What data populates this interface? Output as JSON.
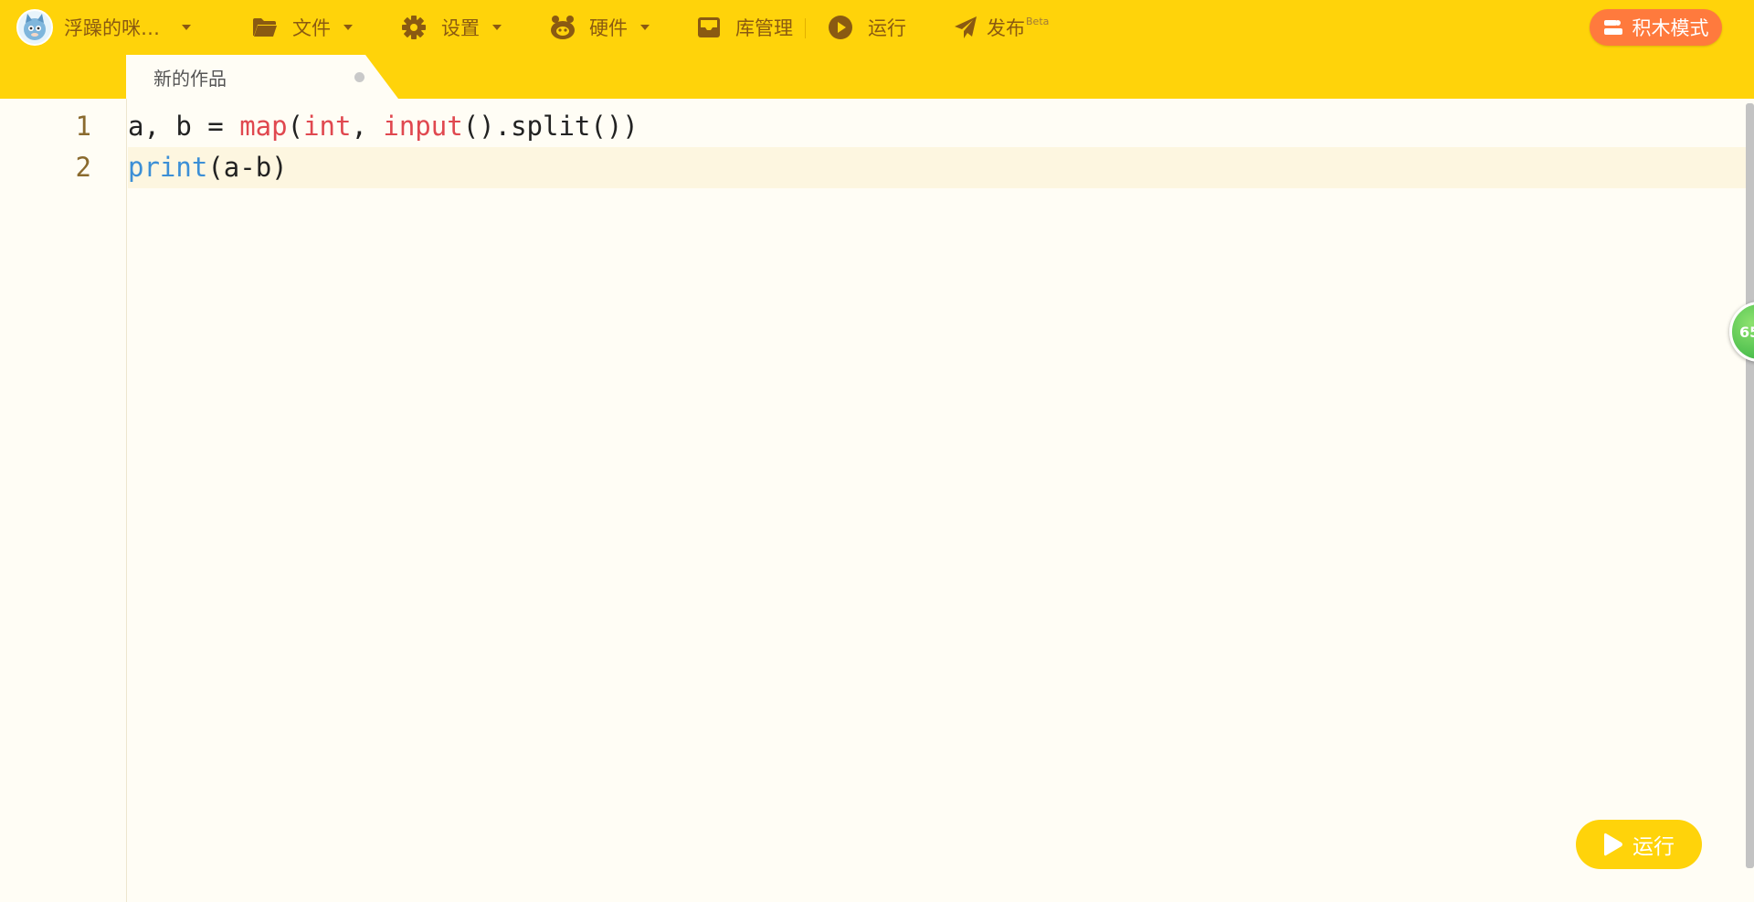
{
  "menubar": {
    "project_name": "浮躁的咪…",
    "file_label": "文件",
    "settings_label": "设置",
    "hardware_label": "硬件",
    "library_label": "库管理",
    "run_label": "运行",
    "publish_label": "发布",
    "publish_badge": "Beta",
    "block_mode_label": "积木模式"
  },
  "tabs": [
    {
      "label": "新的作品",
      "modified": true
    }
  ],
  "editor": {
    "lines": [
      {
        "number": "1"
      },
      {
        "number": "2"
      }
    ],
    "code": {
      "line1": {
        "p1": "a, b = ",
        "p2": "map",
        "p3": "(",
        "p4": "int",
        "p5": ", ",
        "p6": "input",
        "p7": "().split())"
      },
      "line2": {
        "p1": "print",
        "p2": "(a-b)"
      }
    },
    "active_line": 2
  },
  "float_badge": {
    "text": "65"
  },
  "run_button": {
    "label": "运行"
  },
  "colors": {
    "toolbar": "#ffd30a",
    "menu_text": "#8a5a12",
    "block_mode_button": "#ff7a3d",
    "keyword_red": "#e0484f",
    "keyword_blue": "#3c8fd6",
    "line_number": "#8a6a2e",
    "editor_bg": "#fffdf5"
  }
}
